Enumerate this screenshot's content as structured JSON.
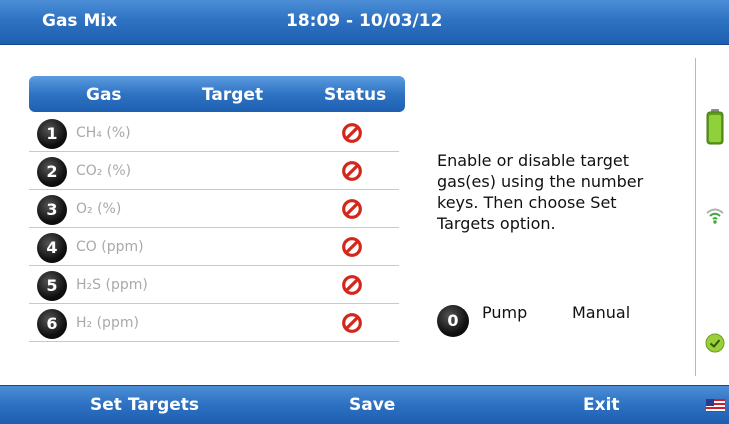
{
  "header": {
    "title": "Gas Mix",
    "datetime": "18:09 - 10/03/12"
  },
  "table": {
    "columns": [
      "Gas",
      "Target",
      "Status"
    ],
    "rows": [
      {
        "key": "1",
        "gas": "CH₄ (%)",
        "status": "disabled"
      },
      {
        "key": "2",
        "gas": "CO₂ (%)",
        "status": "disabled"
      },
      {
        "key": "3",
        "gas": "O₂  (%)",
        "status": "disabled"
      },
      {
        "key": "4",
        "gas": "CO  (ppm)",
        "status": "disabled"
      },
      {
        "key": "5",
        "gas": "H₂S (ppm)",
        "status": "disabled"
      },
      {
        "key": "6",
        "gas": "H₂  (ppm)",
        "status": "disabled"
      }
    ]
  },
  "instructions": "Enable or disable target gas(es) using the number keys. Then choose Set Targets option.",
  "pump": {
    "key": "0",
    "label": "Pump",
    "value": "Manual"
  },
  "side_icons": [
    "battery-icon",
    "signal-icon",
    "check-icon",
    "flag-icon"
  ],
  "softkeys": {
    "left": "Set Targets",
    "center": "Save",
    "right": "Exit"
  },
  "colors": {
    "bar_blue": "#2f73c3",
    "status_red": "#d3271b",
    "battery_green": "#7cc52a"
  }
}
